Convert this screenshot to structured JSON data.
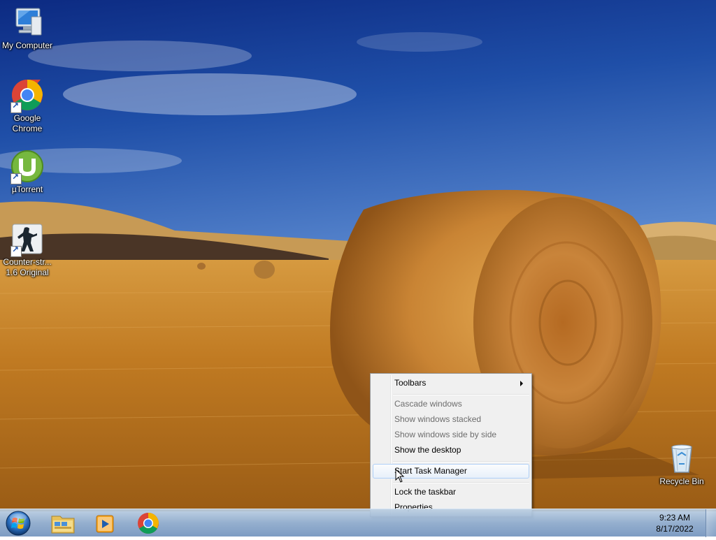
{
  "desktop": {
    "icons": [
      {
        "label": "My Computer",
        "icon": "computer-icon"
      },
      {
        "label": "Google\nChrome",
        "icon": "chrome-icon"
      },
      {
        "label": "µTorrent",
        "icon": "utorrent-icon"
      },
      {
        "label": "Counter-str...\n1.6 Original",
        "icon": "counter-strike-icon"
      },
      {
        "label": "Recycle Bin",
        "icon": "recycle-bin-icon"
      }
    ]
  },
  "context_menu": {
    "items": [
      {
        "label": "Toolbars",
        "enabled": true,
        "submenu": true
      },
      {
        "label": "Cascade windows",
        "enabled": false
      },
      {
        "label": "Show windows stacked",
        "enabled": false
      },
      {
        "label": "Show windows side by side",
        "enabled": false
      },
      {
        "label": "Show the desktop",
        "enabled": true
      },
      {
        "label": "Start Task Manager",
        "enabled": true,
        "highlighted": true
      },
      {
        "label": "Lock the taskbar",
        "enabled": true
      },
      {
        "label": "Properties",
        "enabled": true
      }
    ]
  },
  "taskbar": {
    "start_icon": "windows-orb-icon",
    "pinned": [
      {
        "icon": "windows-explorer-icon"
      },
      {
        "icon": "media-player-icon"
      },
      {
        "icon": "chrome-icon"
      }
    ],
    "clock": {
      "time": "9:23 AM",
      "date": "8/17/2022"
    }
  },
  "colors": {
    "sky_top": "#0d2f8c",
    "sky_bottom": "#3f74c8",
    "field": "#c9862a",
    "taskbar": "#9bb5d3",
    "menu_bg": "#f0f0f0",
    "menu_highlight_border": "#aecff7"
  }
}
